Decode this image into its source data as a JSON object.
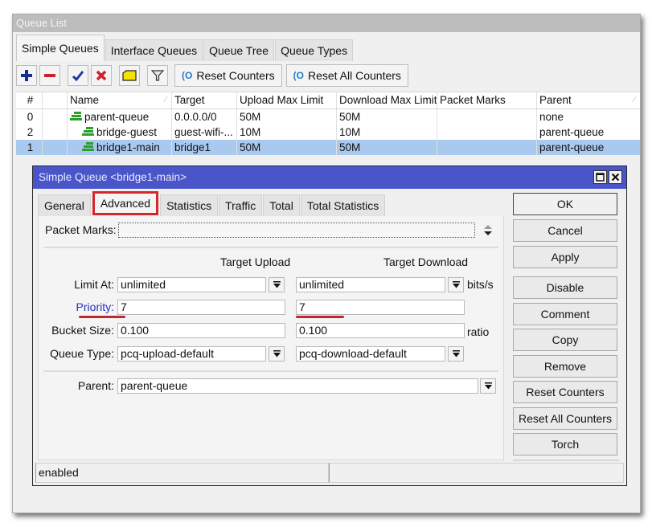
{
  "window": {
    "title": "Queue List"
  },
  "main_tabs": [
    {
      "label": "Simple Queues",
      "active": true
    },
    {
      "label": "Interface Queues",
      "active": false
    },
    {
      "label": "Queue Tree",
      "active": false
    },
    {
      "label": "Queue Types",
      "active": false
    }
  ],
  "toolbar": {
    "icons": [
      "plus-icon",
      "minus-icon",
      "check-icon",
      "x-icon",
      "comment-icon",
      "filter-icon"
    ],
    "reset_counters": "Reset Counters",
    "reset_all_counters": "Reset All Counters"
  },
  "table": {
    "columns": [
      "#",
      "",
      "Name",
      "Target",
      "Upload Max Limit",
      "Download Max Limit",
      "Packet Marks",
      "Parent"
    ],
    "rows": [
      {
        "num": "0",
        "name": "parent-queue",
        "target": "0.0.0.0/0",
        "upload": "50M",
        "download": "50M",
        "packet_marks": "",
        "parent": "none",
        "selected": false
      },
      {
        "num": "2",
        "name": "bridge-guest",
        "target": "guest-wifi-...",
        "upload": "10M",
        "download": "10M",
        "packet_marks": "",
        "parent": "parent-queue",
        "selected": false
      },
      {
        "num": "1",
        "name": "bridge1-main",
        "target": "bridge1",
        "upload": "50M",
        "download": "50M",
        "packet_marks": "",
        "parent": "parent-queue",
        "selected": true
      }
    ]
  },
  "dialog": {
    "title": "Simple Queue <bridge1-main>",
    "tabs": [
      {
        "label": "General",
        "active": false
      },
      {
        "label": "Advanced",
        "active": true
      },
      {
        "label": "Statistics",
        "active": false
      },
      {
        "label": "Traffic",
        "active": false
      },
      {
        "label": "Total",
        "active": false
      },
      {
        "label": "Total Statistics",
        "active": false
      }
    ],
    "packet_marks_label": "Packet Marks:",
    "packet_marks_value": "",
    "col_upload": "Target Upload",
    "col_download": "Target Download",
    "limit_at": {
      "label": "Limit At:",
      "upload": "unlimited",
      "download": "unlimited",
      "unit": "bits/s"
    },
    "priority": {
      "label": "Priority:",
      "upload": "7",
      "download": "7"
    },
    "bucket_size": {
      "label": "Bucket Size:",
      "upload": "0.100",
      "download": "0.100",
      "unit": "ratio"
    },
    "queue_type": {
      "label": "Queue Type:",
      "upload": "pcq-upload-default",
      "download": "pcq-download-default"
    },
    "parent": {
      "label": "Parent:",
      "value": "parent-queue"
    },
    "buttons": [
      "OK",
      "Cancel",
      "Apply",
      "Disable",
      "Comment",
      "Copy",
      "Remove",
      "Reset Counters",
      "Reset All Counters",
      "Torch"
    ],
    "status": "enabled",
    "status_right": ""
  },
  "colors": {
    "dialog_title_bg": "#4a55c9",
    "selected_row": "#a9c9ef",
    "highlight_red": "#d6262c",
    "priority_label": "#2830c0"
  }
}
